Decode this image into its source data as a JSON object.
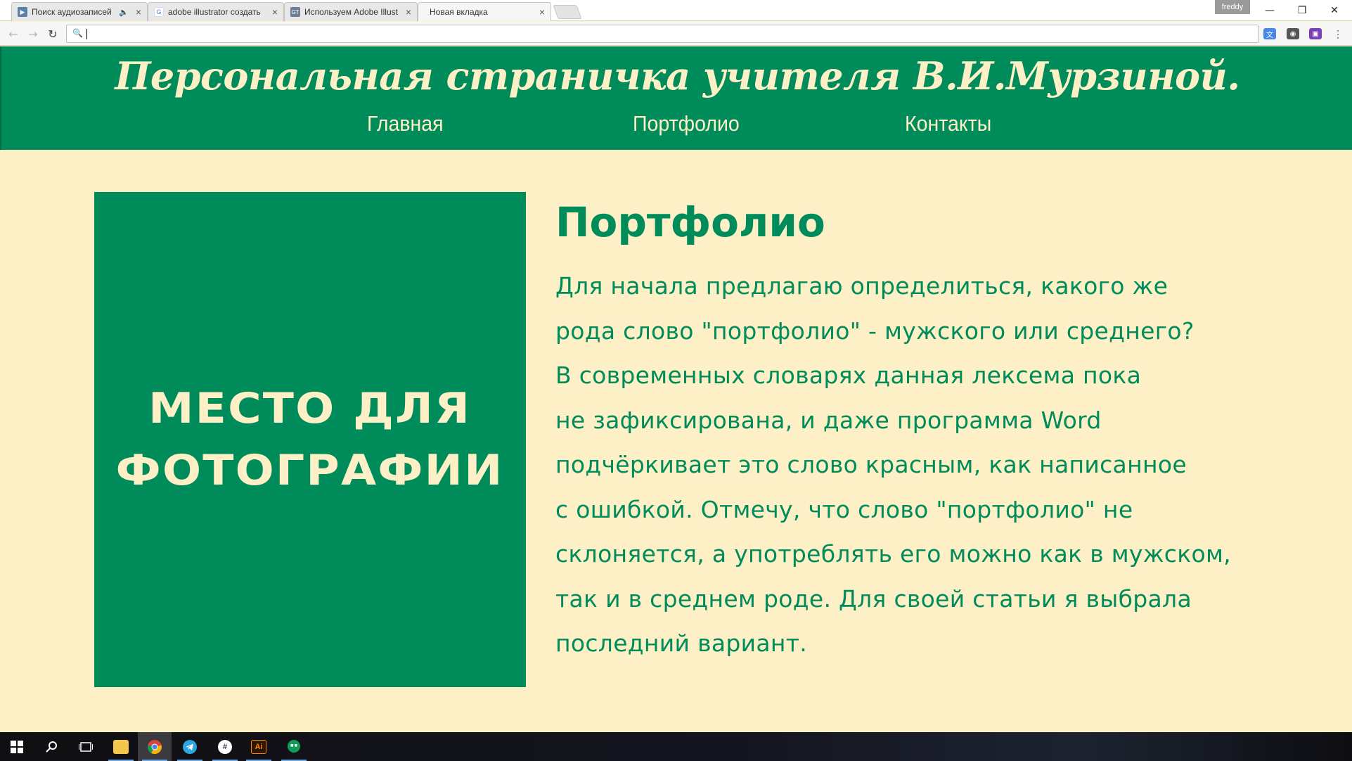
{
  "browser": {
    "tabs": [
      {
        "title": "Поиск аудиозаписей",
        "favicon": "play-video-icon",
        "color": "#5a7fa8",
        "audio": true
      },
      {
        "title": "adobe illustrator создать",
        "favicon": "google-icon",
        "color": "#4285f4",
        "audio": false
      },
      {
        "title": "Используем Adobe Illust",
        "favicon": "site-gt-icon",
        "color": "#6d7f94",
        "audio": false
      },
      {
        "title": "Новая вкладка",
        "favicon": "",
        "color": "",
        "audio": false
      }
    ],
    "profile_name": "freddy",
    "omnibox_value": ""
  },
  "site": {
    "title": "Персональная страничка учителя В.И.Мурзиной.",
    "nav": [
      {
        "label": "Главная"
      },
      {
        "label": "Портфолио"
      },
      {
        "label": "Контакты"
      }
    ],
    "photo_placeholder": {
      "line1": "МЕСТО ДЛЯ",
      "line2": "ФОТОГРАФИИ"
    },
    "content": {
      "title": "Портфолио",
      "lines": [
        "Для начала предлагаю определиться, какого же",
        "рода слово \"портфолио\" - мужского или среднего?",
        "В современных словарях данная лексема пока",
        "не зафиксирована, и даже программа Word",
        "подчёркивает это слово красным, как написанное",
        "с ошибкой. Отмечу, что слово \"портфолио\" не",
        "склоняется, а употреблять его можно как в мужском,",
        "так и в среднем роде. Для своей статьи я выбрала",
        "последний вариант."
      ]
    }
  },
  "colors": {
    "brand_green": "#008b5a",
    "background_cream": "#fdf0c6"
  },
  "taskbar": {
    "items": [
      "windows-start-icon",
      "search-icon",
      "task-view-icon",
      "file-explorer-icon",
      "chrome-icon",
      "telegram-icon",
      "slack-icon",
      "illustrator-icon",
      "hangouts-icon"
    ]
  }
}
